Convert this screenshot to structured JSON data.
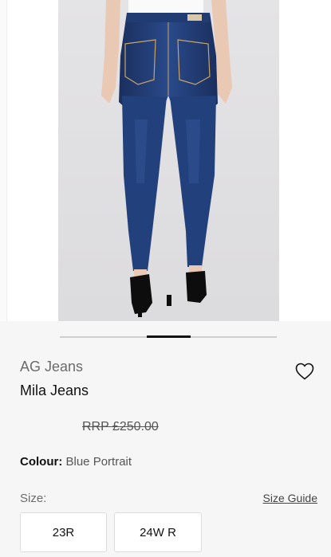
{
  "product": {
    "brand": "AG Jeans",
    "name": "Mila Jeans",
    "rrp": "RRP £250.00",
    "colour_label": "Colour:",
    "colour_value": "Blue Portrait"
  },
  "gallery": {
    "image_alt": "jeans-product-photo",
    "active_slide_fraction": 0.2
  },
  "sizes": {
    "label": "Size:",
    "guide_label": "Size Guide",
    "options": [
      "23R",
      "24W R"
    ]
  },
  "colors": {
    "denim": "#1f3a73",
    "background": "#f6f6f6",
    "accent": "#111111"
  }
}
